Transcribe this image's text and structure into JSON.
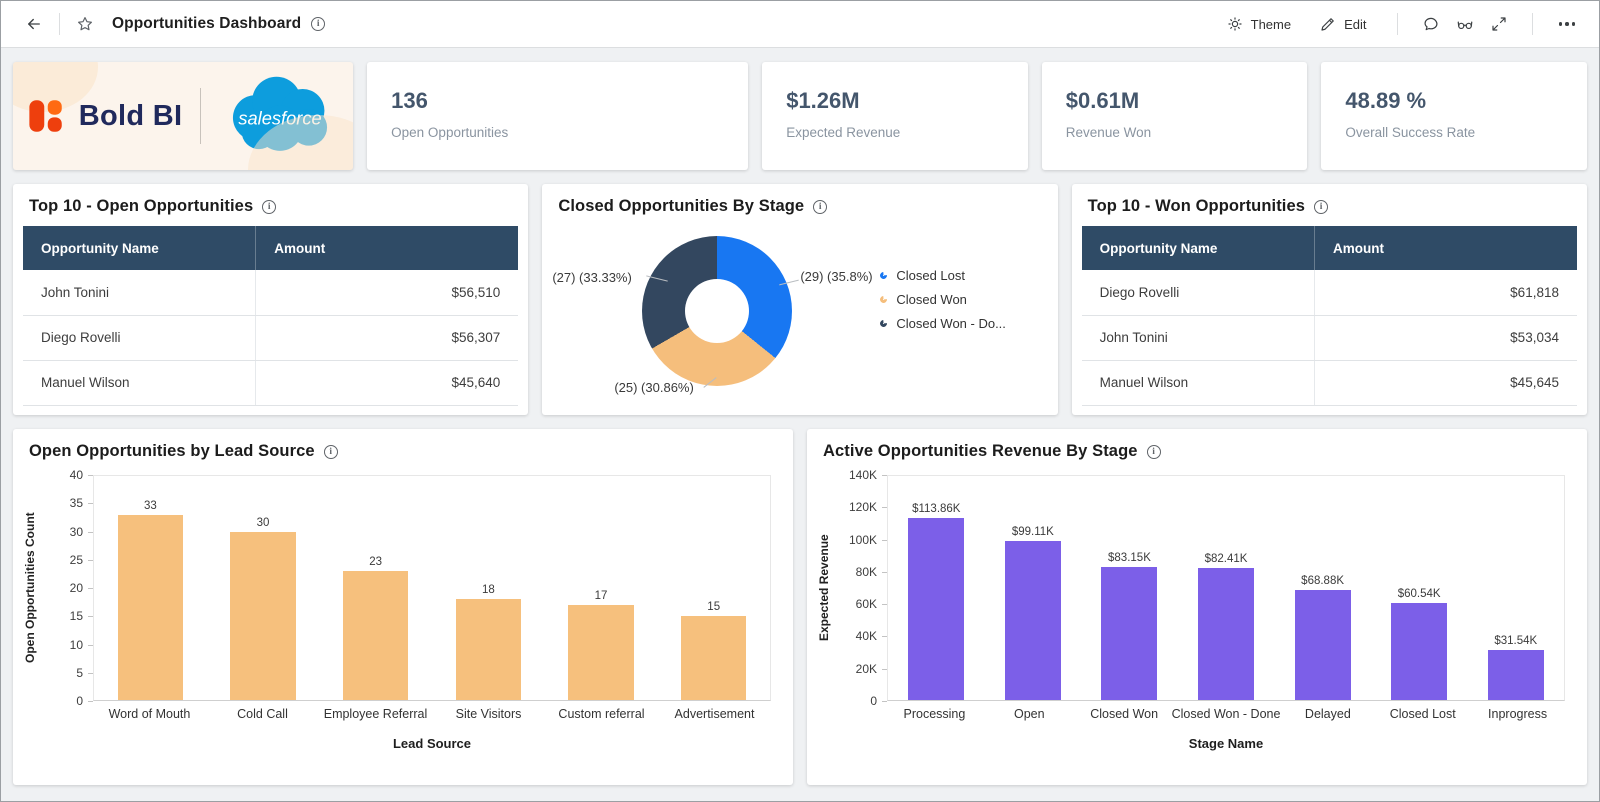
{
  "topbar": {
    "title": "Opportunities Dashboard",
    "theme_label": "Theme",
    "edit_label": "Edit"
  },
  "logo_card": {
    "boldbi_text": "Bold BI",
    "salesforce_text": "salesforce"
  },
  "kpis": [
    {
      "value": "136",
      "label": "Open Opportunities"
    },
    {
      "value": "$1.26M",
      "label": "Expected Revenue"
    },
    {
      "value": "$0.61M",
      "label": "Revenue Won"
    },
    {
      "value": "48.89 %",
      "label": "Overall Success Rate"
    }
  ],
  "open_table": {
    "title": "Top 10 - Open Opportunities",
    "columns": [
      "Opportunity Name",
      "Amount"
    ],
    "rows": [
      [
        "John Tonini",
        "$56,510"
      ],
      [
        "Diego Rovelli",
        "$56,307"
      ],
      [
        "Manuel Wilson",
        "$45,640"
      ]
    ]
  },
  "won_table": {
    "title": "Top 10 - Won Opportunities",
    "columns": [
      "Opportunity Name",
      "Amount"
    ],
    "rows": [
      [
        "Diego Rovelli",
        "$61,818"
      ],
      [
        "John Tonini",
        "$53,034"
      ],
      [
        "Manuel Wilson",
        "$45,645"
      ]
    ]
  },
  "chart_data": [
    {
      "id": "closed-opportunities-by-stage",
      "type": "pie",
      "donut": true,
      "title": "Closed Opportunities By Stage",
      "legend_position": "right",
      "slices": [
        {
          "label": "Closed Lost",
          "count": 29,
          "percent": 35.8,
          "callout": "(29) (35.8%)",
          "color": "#1877f2"
        },
        {
          "label": "Closed Won",
          "count": 25,
          "percent": 30.86,
          "callout": "(25) (30.86%)",
          "color": "#f5be7c"
        },
        {
          "label": "Closed Won - Done",
          "count": 27,
          "percent": 33.33,
          "callout": "(27) (33.33%)",
          "color": "#33475f"
        }
      ],
      "legend_labels": [
        "Closed Lost",
        "Closed Won",
        "Closed Won - Do..."
      ]
    },
    {
      "id": "open-opportunities-by-lead-source",
      "type": "bar",
      "title": "Open Opportunities by Lead Source",
      "categories": [
        "Word of Mouth",
        "Cold Call",
        "Employee Referral",
        "Site Visitors",
        "Custom referral",
        "Advertisement"
      ],
      "values": [
        33,
        30,
        23,
        18,
        17,
        15
      ],
      "labels": [
        "33",
        "30",
        "23",
        "18",
        "17",
        "15"
      ],
      "xlabel": "Lead Source",
      "ylabel": "Open Opportunities Count",
      "ylim": [
        0,
        40
      ],
      "yticks": [
        "40",
        "35",
        "30",
        "25",
        "20",
        "15",
        "10",
        "5",
        "0"
      ],
      "bar_color": "#f6c07d",
      "grid": false
    },
    {
      "id": "active-opportunities-revenue-by-stage",
      "type": "bar",
      "title": "Active Opportunities Revenue By Stage",
      "categories": [
        "Processing",
        "Open",
        "Closed Won",
        "Closed Won - Done",
        "Delayed",
        "Closed Lost",
        "Inprogress"
      ],
      "values": [
        113.86,
        99.11,
        83.15,
        82.41,
        68.88,
        60.54,
        31.54
      ],
      "labels": [
        "$113.86K",
        "$99.11K",
        "$83.15K",
        "$82.41K",
        "$68.88K",
        "$60.54K",
        "$31.54K"
      ],
      "xlabel": "Stage Name",
      "ylabel": "Expected Revenue",
      "ylim": [
        0,
        140
      ],
      "yticks": [
        "140K",
        "120K",
        "100K",
        "80K",
        "60K",
        "40K",
        "20K",
        "0"
      ],
      "bar_color": "#7c5fe8",
      "grid": false
    }
  ]
}
